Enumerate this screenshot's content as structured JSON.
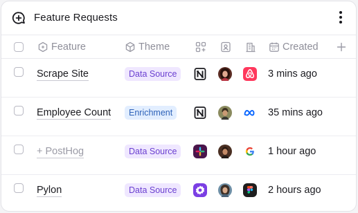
{
  "header": {
    "title": "Feature Requests",
    "title_icon": "chat-plus-icon",
    "menu_icon": "vertical-dots-icon"
  },
  "columns": {
    "select_all_icon": "checkbox",
    "feature_label": "Feature",
    "feature_icon": "sparkle-box-icon",
    "theme_label": "Theme",
    "theme_icon": "cube-icon",
    "apps_icon": "apps-grid-icon",
    "contact_icon": "contact-card-icon",
    "company_icon": "building-icon",
    "created_label": "Created",
    "created_icon": "calendar-icon",
    "add_icon": "plus-icon"
  },
  "rows": [
    {
      "feature": "Scrape Site",
      "muted": false,
      "theme": "Data Source",
      "theme_color": "purple",
      "source_icon": "notion-icon",
      "avatar_icon": "avatar-woman-icon",
      "company_icon": "airbnb-icon",
      "created": "3 mins ago"
    },
    {
      "feature": "Employee Count",
      "muted": false,
      "theme": "Enrichment",
      "theme_color": "blue",
      "source_icon": "notion-icon",
      "avatar_icon": "avatar-man-icon",
      "company_icon": "meta-icon",
      "created": "35 mins ago"
    },
    {
      "feature": "+ PostHog",
      "muted": true,
      "theme": "Data Source",
      "theme_color": "purple",
      "source_icon": "slack-icon",
      "avatar_icon": "avatar-man-icon",
      "company_icon": "google-icon",
      "created": "1 hour ago"
    },
    {
      "feature": "Pylon",
      "muted": false,
      "theme": "Data Source",
      "theme_color": "purple",
      "source_icon": "pylon-icon",
      "avatar_icon": "avatar-woman-icon",
      "company_icon": "figma-icon",
      "created": "2 hours ago"
    }
  ],
  "colors": {
    "purple_pill_bg": "#efe7ff",
    "purple_pill_text": "#6a3fd0",
    "blue_pill_bg": "#e2eeff",
    "blue_pill_text": "#2e62b8"
  }
}
